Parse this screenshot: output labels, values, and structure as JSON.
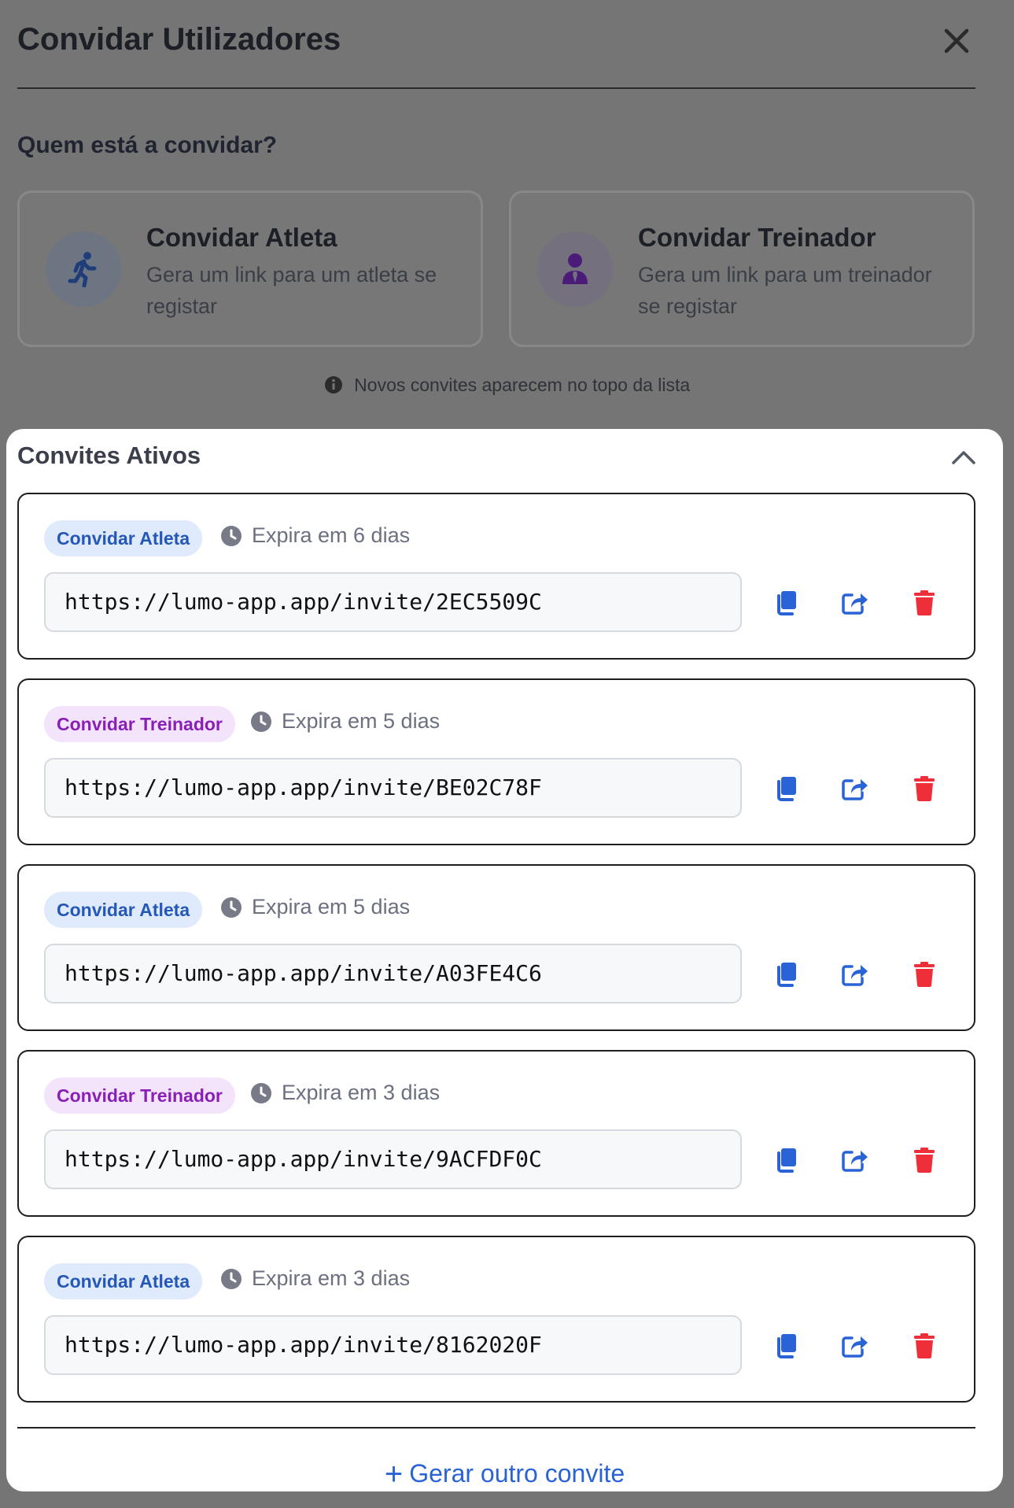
{
  "header": {
    "title": "Convidar Utilizadores"
  },
  "question": "Quem está a convidar?",
  "options": [
    {
      "title": "Convidar Atleta",
      "description": "Gera um link para um atleta se registar"
    },
    {
      "title": "Convidar Treinador",
      "description": "Gera um link para um treinador se registar"
    }
  ],
  "notice": "Novos convites aparecem no topo da lista",
  "active": {
    "title": "Convites Ativos",
    "invites": [
      {
        "type": "Convidar Atleta",
        "expiry": "Expira em 6 dias",
        "link": "https://lumo-app.app/invite/2EC5509C"
      },
      {
        "type": "Convidar Treinador",
        "expiry": "Expira em 5 dias",
        "link": "https://lumo-app.app/invite/BE02C78F"
      },
      {
        "type": "Convidar Atleta",
        "expiry": "Expira em 5 dias",
        "link": "https://lumo-app.app/invite/A03FE4C6"
      },
      {
        "type": "Convidar Treinador",
        "expiry": "Expira em 3 dias",
        "link": "https://lumo-app.app/invite/9ACFDF0C"
      },
      {
        "type": "Convidar Atleta",
        "expiry": "Expira em 3 dias",
        "link": "https://lumo-app.app/invite/8162020F"
      }
    ],
    "generate_label": "Gerar outro convite"
  },
  "colors": {
    "primary": "#2a63d6",
    "danger": "#ee2f3a",
    "athlete_badge_bg": "#dfeafd",
    "athlete_badge_text": "#2557b7",
    "coach_badge_bg": "#f4e4fb",
    "coach_badge_text": "#8a1fb8"
  },
  "icons": {
    "close": "close-icon",
    "athlete": "running-person-icon",
    "coach": "user-tie-icon",
    "info": "info-icon",
    "collapse": "chevron-up-icon",
    "clock": "clock-icon",
    "copy": "copy-icon",
    "share": "share-icon",
    "delete": "trash-icon",
    "add": "plus-icon"
  }
}
